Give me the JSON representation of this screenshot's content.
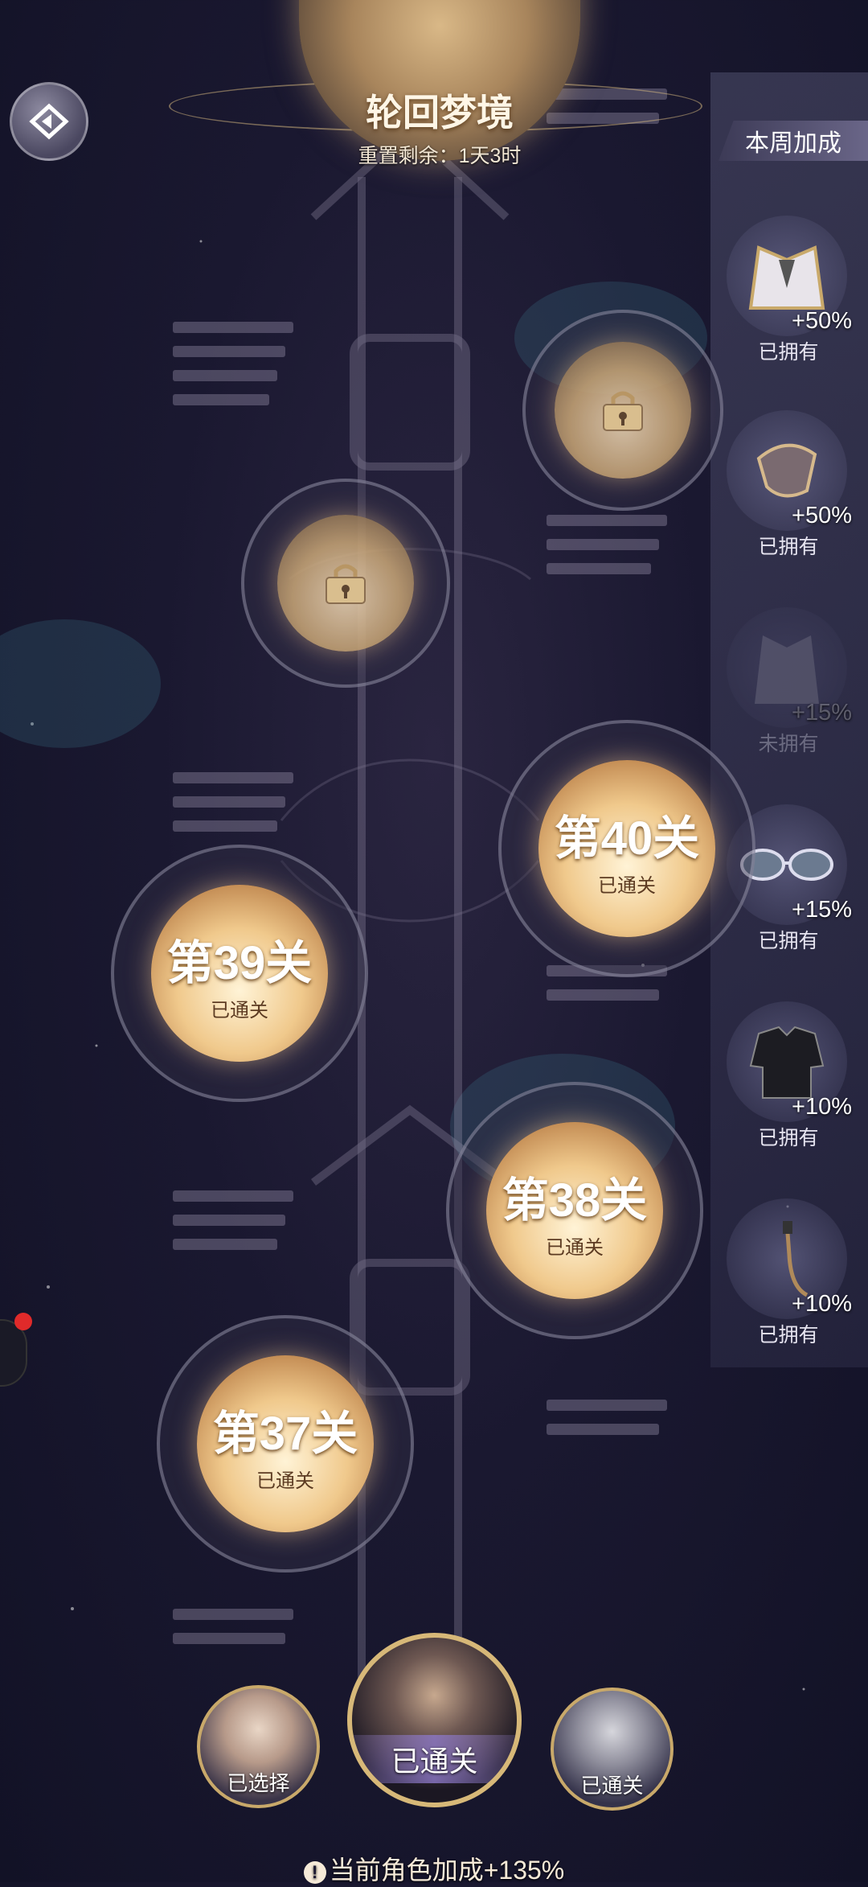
{
  "header": {
    "title": "轮回梦境",
    "reset_text": "重置剩余：1天3时"
  },
  "panel": {
    "tab_label": "本周加成",
    "items": [
      {
        "icon": "outfit-icon",
        "bonus": "+50%",
        "status": "已拥有",
        "owned": true
      },
      {
        "icon": "mask-icon",
        "bonus": "+50%",
        "status": "已拥有",
        "owned": true
      },
      {
        "icon": "suit-icon",
        "bonus": "+15%",
        "status": "未拥有",
        "owned": false
      },
      {
        "icon": "glasses-icon",
        "bonus": "+15%",
        "status": "已拥有",
        "owned": true
      },
      {
        "icon": "shirt-icon",
        "bonus": "+10%",
        "status": "已拥有",
        "owned": true
      },
      {
        "icon": "earring-icon",
        "bonus": "+10%",
        "status": "已拥有",
        "owned": true
      }
    ]
  },
  "levels": [
    {
      "label": "第40关",
      "status": "已通关"
    },
    {
      "label": "第39关",
      "status": "已通关"
    },
    {
      "label": "第38关",
      "status": "已通关"
    },
    {
      "label": "第37关",
      "status": "已通关"
    }
  ],
  "characters": [
    {
      "status": "已选择"
    },
    {
      "status": "已通关"
    },
    {
      "status": "已通关"
    }
  ],
  "footer": {
    "text": "当前角色加成+135%"
  },
  "colors": {
    "accent_gold": "#c9a96a",
    "core_gold": "#f0c98c"
  }
}
